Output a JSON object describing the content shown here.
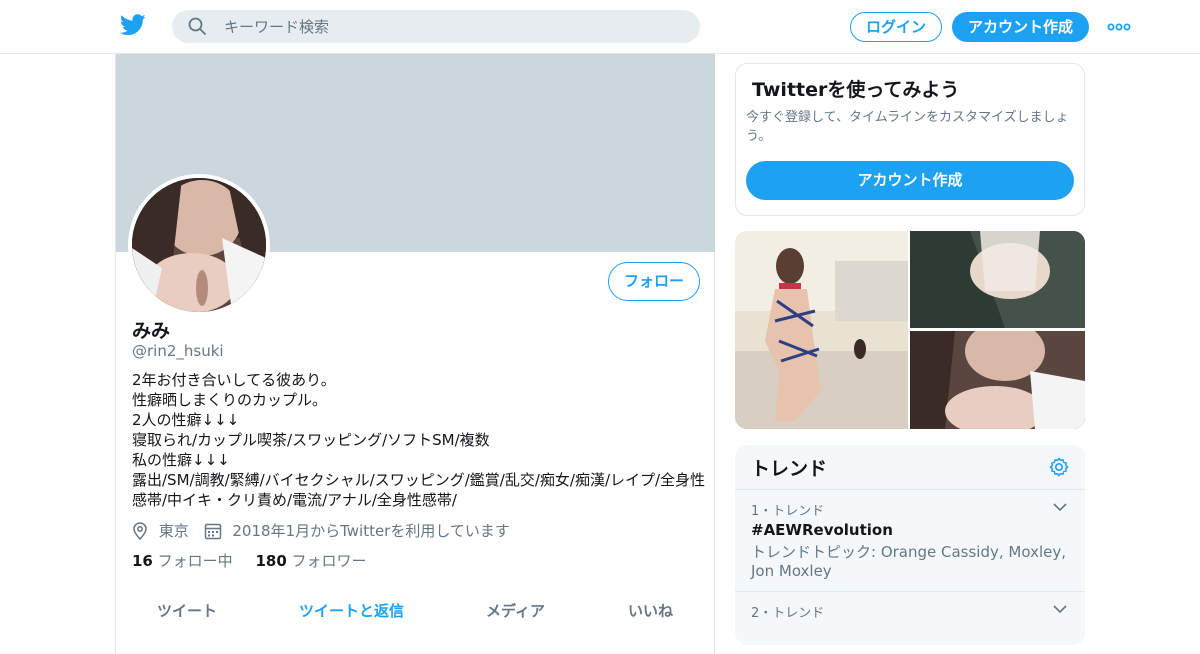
{
  "header": {
    "search_placeholder": "キーワード検索",
    "login_label": "ログイン",
    "signup_label": "アカウント作成"
  },
  "profile": {
    "name": "みみ",
    "handle": "@rin2_hsuki",
    "follow_label": "フォロー",
    "bio_lines": [
      "2年お付き合いしてる彼あり。",
      "性癖晒しまくりのカップル。",
      "2人の性癖↓↓↓",
      "寝取られ/カップル喫茶/スワッピング/ソフトSM/複数",
      "私の性癖↓↓↓",
      "露出/SM/調教/緊縛/バイセクシャル/スワッピング/鑑賞/乱交/痴女/痴漢/レイプ/全身性",
      "感帯/中イキ・クリ責め/電流/アナル/全身性感帯/"
    ],
    "location": "東京",
    "joined": "2018年1月からTwitterを利用しています",
    "following_count": "16",
    "following_label": "フォロー中",
    "followers_count": "180",
    "followers_label": "フォロワー",
    "tabs": [
      "ツイート",
      "ツイートと返信",
      "メディア",
      "いいね"
    ],
    "active_tab": "ツイートと返信"
  },
  "signup_card": {
    "title": "Twitterを使ってみよう",
    "description": "今すぐ登録して、タイムラインをカスタマイズしましょう。",
    "button_label": "アカウント作成"
  },
  "trends": {
    "title": "トレンド",
    "items": [
      {
        "rank": "1・トレンド",
        "tag": "#AEWRevolution",
        "topic": "トレンドトピック: Orange Cassidy, Moxley, Jon Moxley"
      },
      {
        "rank": "2・トレンド",
        "tag": "",
        "topic": ""
      }
    ]
  },
  "colors": {
    "accent": "#1da1f2",
    "banner": "#ccd6dd",
    "secondary_text": "#657786"
  }
}
